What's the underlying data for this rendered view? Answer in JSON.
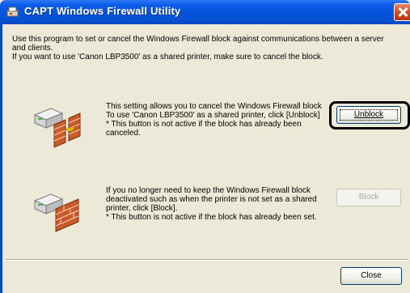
{
  "window": {
    "title": "CAPT Windows Firewall Utility",
    "icons": {
      "app": "canon-printer-icon",
      "close": "close-icon"
    },
    "colors": {
      "titlebar": "#0553db",
      "background": "#ece9d8",
      "close": "#cf4a25"
    }
  },
  "intro": {
    "line1": "Use this program to set or cancel the Windows Firewall block against communications between a server",
    "line2": "and clients.",
    "line3": "If you want to use 'Canon LBP3500' as a shared printer, make sure to cancel the block."
  },
  "unblock_section": {
    "illustration": "printer-firewall-open-icon",
    "line1": "This setting allows you to cancel the Windows Firewall block",
    "line2": "To use 'Canon LBP3500' as a shared printer, click [Unblock]",
    "line3": "* This button is not active if the block has already been",
    "line4": "canceled.",
    "button_label": "Unblock"
  },
  "block_section": {
    "illustration": "printer-firewall-wall-icon",
    "line1": "If you no longer need to keep the Windows Firewall block",
    "line2": "deactivated such as when the printer is not set as a shared",
    "line3": "printer, click [Block].",
    "line4": "* This button is not active if the block has already been set.",
    "button_label": "Block"
  },
  "footer": {
    "close_label": "Close"
  }
}
